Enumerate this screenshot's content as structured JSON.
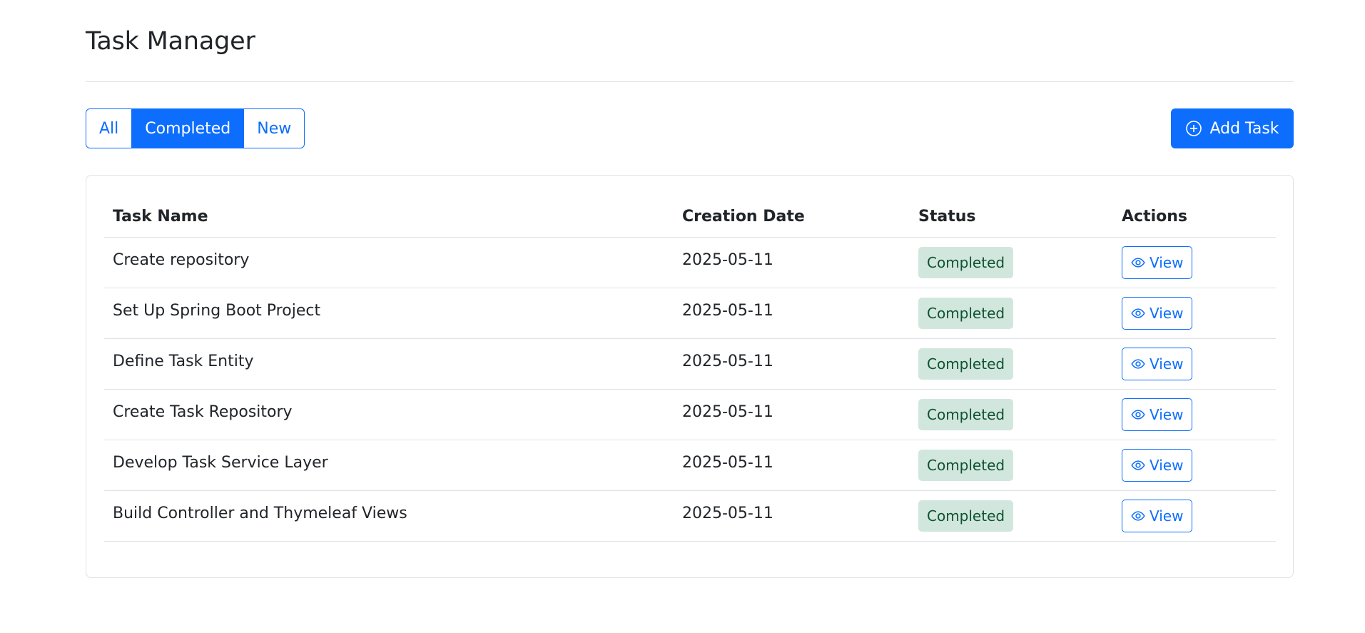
{
  "header": {
    "title": "Task Manager"
  },
  "filters": [
    {
      "label": "All",
      "active": false
    },
    {
      "label": "Completed",
      "active": true
    },
    {
      "label": "New",
      "active": false
    }
  ],
  "add_button": {
    "label": "Add Task",
    "icon": "plus-circle-icon"
  },
  "table": {
    "columns": [
      "Task Name",
      "Creation Date",
      "Status",
      "Actions"
    ],
    "rows": [
      {
        "name": "Create repository",
        "date": "2025-05-11",
        "status": "Completed",
        "action": "View"
      },
      {
        "name": "Set Up Spring Boot Project",
        "date": "2025-05-11",
        "status": "Completed",
        "action": "View"
      },
      {
        "name": "Define Task Entity",
        "date": "2025-05-11",
        "status": "Completed",
        "action": "View"
      },
      {
        "name": "Create Task Repository",
        "date": "2025-05-11",
        "status": "Completed",
        "action": "View"
      },
      {
        "name": "Develop Task Service Layer",
        "date": "2025-05-11",
        "status": "Completed",
        "action": "View"
      },
      {
        "name": "Build Controller and Thymeleaf Views",
        "date": "2025-05-11",
        "status": "Completed",
        "action": "View"
      }
    ]
  },
  "colors": {
    "primary": "#0d6efd",
    "success_bg": "#d1e7dd",
    "success_text": "#0f5132",
    "border": "#dee2e6"
  }
}
